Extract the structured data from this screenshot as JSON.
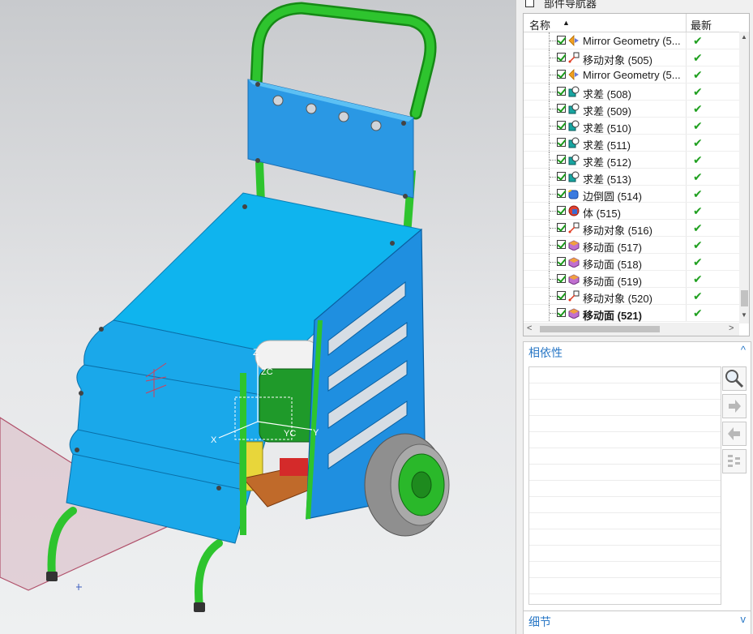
{
  "navigator": {
    "title": "部件导航器",
    "columns": {
      "name": "名称",
      "latest": "最新"
    },
    "rows": [
      {
        "label": "Mirror Geometry (5...",
        "icon": "mirror-geometry-icon",
        "status": "✔",
        "bold": false
      },
      {
        "label": "移动对象 (505)",
        "icon": "move-object-icon",
        "status": "✔",
        "bold": false
      },
      {
        "label": "Mirror Geometry (5...",
        "icon": "mirror-geometry-icon",
        "status": "✔",
        "bold": false
      },
      {
        "label": "求差 (508)",
        "icon": "subtract-icon",
        "status": "✔",
        "bold": false
      },
      {
        "label": "求差 (509)",
        "icon": "subtract-icon",
        "status": "✔",
        "bold": false
      },
      {
        "label": "求差 (510)",
        "icon": "subtract-icon",
        "status": "✔",
        "bold": false
      },
      {
        "label": "求差 (511)",
        "icon": "subtract-icon",
        "status": "✔",
        "bold": false
      },
      {
        "label": "求差 (512)",
        "icon": "subtract-icon",
        "status": "✔",
        "bold": false
      },
      {
        "label": "求差 (513)",
        "icon": "subtract-icon",
        "status": "✔",
        "bold": false
      },
      {
        "label": "边倒圆 (514)",
        "icon": "edge-blend-icon",
        "status": "✔",
        "bold": false
      },
      {
        "label": "体 (515)",
        "icon": "body-icon",
        "status": "✔",
        "bold": false
      },
      {
        "label": "移动对象 (516)",
        "icon": "move-object-icon",
        "status": "✔",
        "bold": false
      },
      {
        "label": "移动面 (517)",
        "icon": "move-face-icon",
        "status": "✔",
        "bold": false
      },
      {
        "label": "移动面 (518)",
        "icon": "move-face-icon",
        "status": "✔",
        "bold": false
      },
      {
        "label": "移动面 (519)",
        "icon": "move-face-icon",
        "status": "✔",
        "bold": false
      },
      {
        "label": "移动对象 (520)",
        "icon": "move-object-icon",
        "status": "✔",
        "bold": false
      },
      {
        "label": "移动面 (521)",
        "icon": "move-face-icon",
        "status": "✔",
        "bold": true
      }
    ]
  },
  "dependencies": {
    "title": "相依性",
    "chevron": "^"
  },
  "details": {
    "title": "细节",
    "chevron": "v"
  },
  "viewport": {
    "csys_labels": {
      "z": "Z",
      "zc": "ZC",
      "x": "X",
      "y": "Y",
      "yc": "YC"
    },
    "colors": {
      "frame": "#1fb51f",
      "cover": "#0fb4ee",
      "side_panel": "#1f8fe0",
      "wheel": "#8f8f8f",
      "hub": "#2ab82a",
      "plane": "#b87080"
    }
  }
}
